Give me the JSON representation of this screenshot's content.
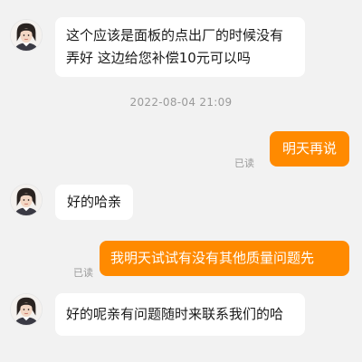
{
  "messages": {
    "m1": {
      "sender": "agent",
      "text": "这个应该是面板的点出厂的时候没有弄好  这边给您补偿10元可以吗"
    },
    "timestamp": "2022-08-04 21:09",
    "m2": {
      "sender": "user",
      "text": "明天再说",
      "status": "已读"
    },
    "m3": {
      "sender": "agent",
      "text": "好的哈亲"
    },
    "m4": {
      "sender": "user",
      "text": "我明天试试有没有其他质量问题先",
      "status": "已读"
    },
    "m5": {
      "sender": "agent",
      "text": "好的呢亲有问题随时来联系我们的哈"
    }
  },
  "colors": {
    "background": "#f2f2f2",
    "incoming_bubble": "#ffffff",
    "outgoing_bubble": "#ff8a00",
    "read_text": "#9a9a9a"
  },
  "icons": {
    "agent_avatar": "agent-avatar-icon"
  }
}
